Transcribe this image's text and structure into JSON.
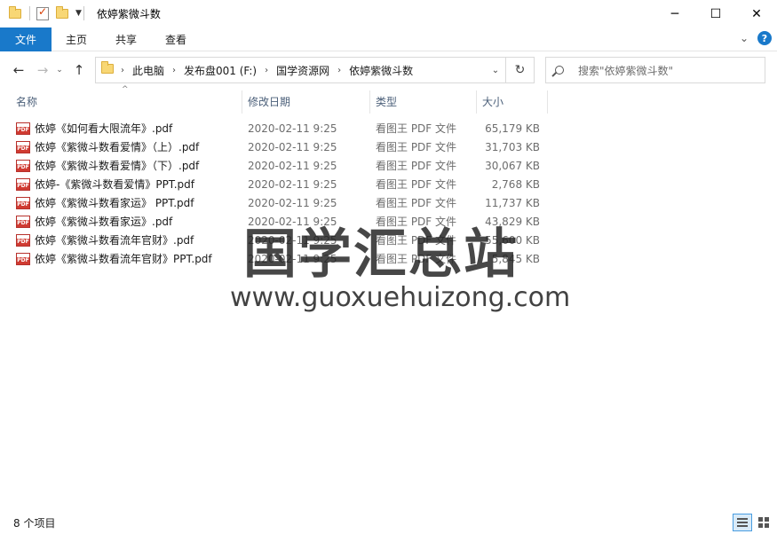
{
  "window": {
    "title": "依婷紫微斗数",
    "minimize_icon": "─",
    "maximize_icon": "☐",
    "close_icon": "✕"
  },
  "ribbon": {
    "tabs": [
      {
        "label": "文件"
      },
      {
        "label": "主页"
      },
      {
        "label": "共享"
      },
      {
        "label": "查看"
      }
    ]
  },
  "nav": {
    "back_icon": "←",
    "forward_icon": "→",
    "recent_icon": "⌄",
    "up_icon": "↑",
    "breadcrumb": [
      "此电脑",
      "发布盘001 (F:)",
      "国学资源网",
      "依婷紫微斗数"
    ],
    "search_placeholder": "搜索\"依婷紫微斗数\""
  },
  "columns": {
    "name": "名称",
    "date": "修改日期",
    "type": "类型",
    "size": "大小"
  },
  "files": [
    {
      "name": "依婷《如何看大限流年》.pdf",
      "date": "2020-02-11 9:25",
      "type": "看图王 PDF 文件",
      "size": "65,179 KB"
    },
    {
      "name": "依婷《紫微斗数看爱情》（上）.pdf",
      "date": "2020-02-11 9:25",
      "type": "看图王 PDF 文件",
      "size": "31,703 KB"
    },
    {
      "name": "依婷《紫微斗数看爱情》（下）.pdf",
      "date": "2020-02-11 9:25",
      "type": "看图王 PDF 文件",
      "size": "30,067 KB"
    },
    {
      "name": "依婷-《紫微斗数看爱情》PPT.pdf",
      "date": "2020-02-11 9:25",
      "type": "看图王 PDF 文件",
      "size": "2,768 KB"
    },
    {
      "name": "依婷《紫微斗数看家运》 PPT.pdf",
      "date": "2020-02-11 9:25",
      "type": "看图王 PDF 文件",
      "size": "11,737 KB"
    },
    {
      "name": "依婷《紫微斗数看家运》.pdf",
      "date": "2020-02-11 9:25",
      "type": "看图王 PDF 文件",
      "size": "43,829 KB"
    },
    {
      "name": "依婷《紫微斗数看流年官财》.pdf",
      "date": "2020-02-11 9:25",
      "type": "看图王 PDF 文件",
      "size": "55,600 KB"
    },
    {
      "name": "依婷《紫微斗数看流年官财》PPT.pdf",
      "date": "2020-02-11 9:25",
      "type": "看图王 PDF 文件",
      "size": "5,845 KB"
    }
  ],
  "watermark": {
    "line1": "国学汇总站",
    "line2": "www.guoxuehuizong.com"
  },
  "status": {
    "item_count": "8 个项目"
  },
  "colors": {
    "accent": "#1979ca",
    "header_text": "#4c607a"
  }
}
